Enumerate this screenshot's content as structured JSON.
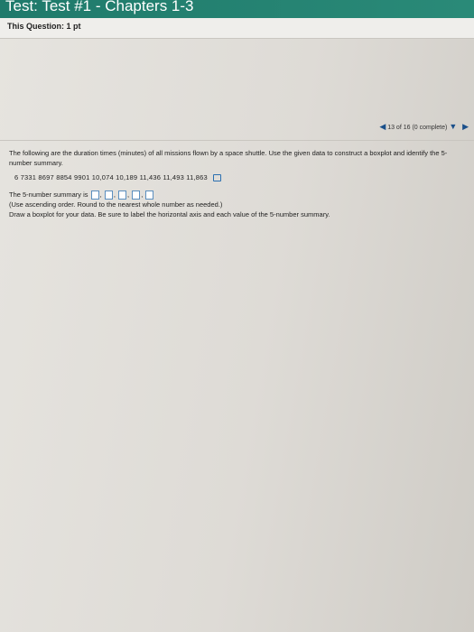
{
  "header": {
    "title": "Test: Test #1 - Chapters 1-3"
  },
  "question": {
    "label": "This Question: 1 pt",
    "nav_text": "13 of 16 (0 complete)",
    "prompt": "The following are the duration times (minutes) of all missions flown by a space shuttle. Use the given data to construct a boxplot and identify the 5-number summary.",
    "data_values": "6  7331  8697  8854  9901  10,074  10,189  11,436  11,493  11,863",
    "summary_prefix": "The 5-number summary is",
    "summary_sep": ",",
    "instruction": "(Use ascending order. Round to the nearest whole number as needed.)",
    "draw_text": "Draw a boxplot for your data.  Be sure to label the horizontal axis and each value of the 5-number summary."
  }
}
